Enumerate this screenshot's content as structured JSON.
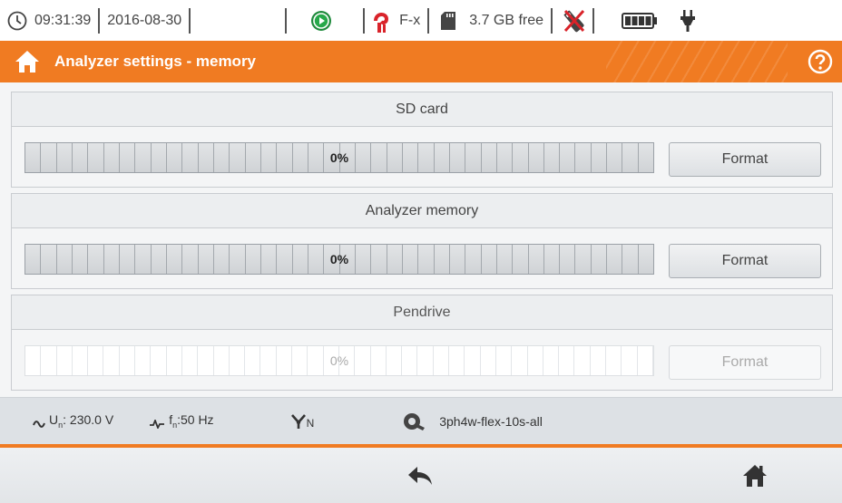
{
  "status_bar": {
    "time": "09:31:39",
    "date": "2016-08-30",
    "clamp_type": "F-x",
    "sd_free": "3.7 GB free",
    "icons": [
      "clock-icon",
      "record-play-icon",
      "current-clamp-icon",
      "sd-card-icon",
      "usb-disconnected-icon",
      "battery-icon",
      "power-plug-icon"
    ]
  },
  "header": {
    "title": "Analyzer settings - memory"
  },
  "panels": [
    {
      "title": "SD card",
      "usage": "0%",
      "usage_fraction": 0,
      "button": "Format",
      "enabled": true
    },
    {
      "title": "Analyzer memory",
      "usage": "0%",
      "usage_fraction": 0,
      "button": "Format",
      "enabled": true
    },
    {
      "title": "Pendrive",
      "usage": "0%",
      "usage_fraction": 0,
      "button": "Format",
      "enabled": false
    }
  ],
  "info_bar": {
    "voltage_prefix": "U",
    "voltage_sub": "n",
    "voltage_value": ": 230.0 V",
    "freq_prefix": "f",
    "freq_sub": "n",
    "freq_value": ":50 Hz",
    "config_name": "3ph4w-flex-10s-all",
    "network_sub": "N"
  },
  "colors": {
    "accent": "#f07b22",
    "record_green": "#27a84a",
    "clamp_red": "#d9232a"
  }
}
